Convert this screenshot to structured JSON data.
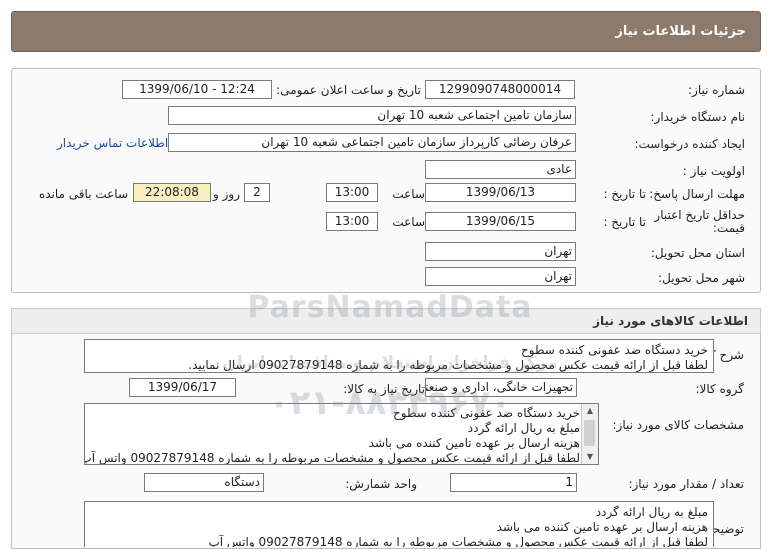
{
  "header": {
    "title": "جزئیات اطلاعات نیاز"
  },
  "fields": {
    "need_number_label": "شماره نیاز:",
    "need_number": "1299090748000014",
    "announce_label": "تاریخ و ساعت اعلان عمومی:",
    "announce_value": "1399/06/10 - 12:24",
    "buyer_org_label": "نام دستگاه خریدار:",
    "buyer_org": "سازمان تامین اجتماعی شعبه 10 تهران",
    "creator_label": "ایجاد کننده درخواست:",
    "creator": "عرفان رضائی کارپرداز سازمان تامین اجتماعی شعبه 10 تهران",
    "contact_link": "اطلاعات تماس خریدار",
    "priority_label": "اولویت نیاز :",
    "priority": "عادی",
    "reply_deadline_label": "مهلت ارسال پاسخ:",
    "to_date_label": "تا تاریخ :",
    "reply_date": "1399/06/13",
    "time_label": "ساعت",
    "reply_time": "13:00",
    "days_value": "2",
    "days_label": "روز و",
    "remaining_time": "22:08:08",
    "remaining_label": "ساعت باقی مانده",
    "price_validity_label_1": "حداقل تاریخ اعتبار",
    "price_validity_label_2": "قیمت:",
    "validity_date": "1399/06/15",
    "validity_time": "13:00",
    "province_label": "استان محل تحویل:",
    "province": "تهران",
    "city_label": "شهر محل تحویل:",
    "city": "تهران"
  },
  "goods": {
    "section_title": "اطلاعات کالاهای مورد نیاز",
    "summary_label": "شرح کلی نیاز:",
    "summary_lines": [
      "خرید دستگاه ضد عفونی کننده سطوح",
      "لطفا قبل از ارائه قیمت عکس محصول و مشخصات مربوطه را به شماره 09027879148 ارسال نمایید."
    ],
    "group_label": "گروه کالا:",
    "group": "تجهیزات خانگی، اداری و صنعتی",
    "need_date_label": "تاریخ نیاز به کالا:",
    "need_date": "1399/06/17",
    "specs_label": "مشخصات کالای مورد نیاز:",
    "specs_lines": [
      "خرید دستگاه ضد عفونی کننده سطوح",
      "مبلغ به ریال ارائه گردد",
      "هزینه ارسال بر عهده تامین کننده می باشد",
      "لطفا قبل از ارائه قیمت عکس محصول و مشخصات مربوطه را به شماره 09027879148 واتس آپ"
    ],
    "quantity_label": "تعداد / مقدار مورد نیاز:",
    "quantity": "1",
    "unit_label": "واحد شمارش:",
    "unit": "دستگاه",
    "buyer_notes_label": "توضیحات خریدار:",
    "buyer_notes_lines": [
      "مبلغ به ریال ارائه گردد",
      "هزینه ارسال بر عهده تامین کننده می باشد",
      "لطفا قبل از ارائه قیمت عکس محصول و مشخصات مربوطه را به شماره 09027879148 واتس آپ"
    ]
  },
  "watermark": {
    "brand": "ParsNamadData",
    "tagline": "مرکز فراخوان استعلام و مناقصات ایران",
    "phone": "۰۲۱-۸۸۳۴۹۶۷۰"
  },
  "icons": {
    "scroll_up": "triangle-up-icon",
    "scroll_down": "triangle-down-icon"
  }
}
